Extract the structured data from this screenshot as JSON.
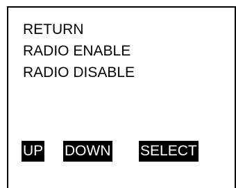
{
  "menu": {
    "items": [
      {
        "label": "RETURN"
      },
      {
        "label": "RADIO ENABLE"
      },
      {
        "label": "RADIO DISABLE"
      }
    ]
  },
  "softkeys": {
    "up_label": "UP",
    "down_label": "DOWN",
    "select_label": "SELECT"
  },
  "colors": {
    "background": "#ffffff",
    "foreground": "#000000",
    "softkey_background": "#000000",
    "softkey_text": "#ffffff"
  }
}
